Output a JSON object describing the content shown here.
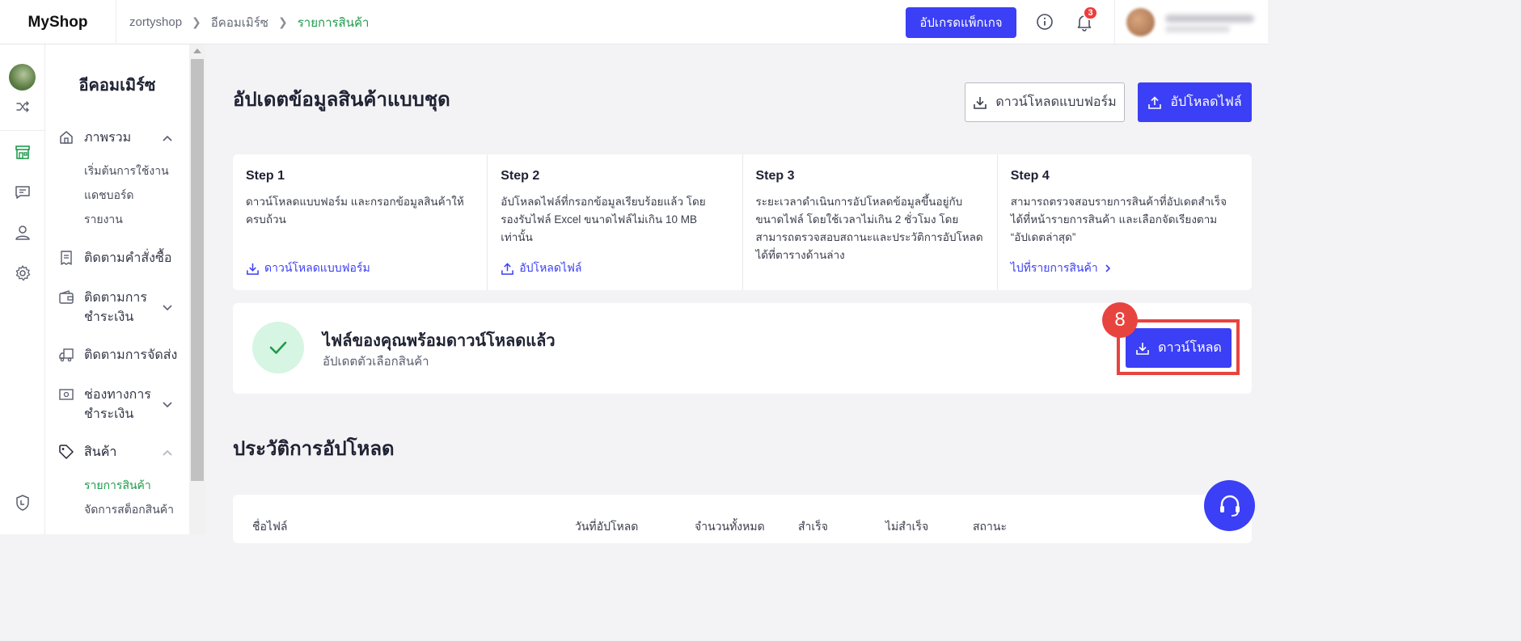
{
  "app": {
    "logo": "MyShop"
  },
  "breadcrumb": {
    "items": [
      "zortyshop",
      "อีคอมเมิร์ซ",
      "รายการสินค้า"
    ]
  },
  "topbar": {
    "upgrade_label": "อัปเกรดแพ็กเกจ",
    "notification_count": "3"
  },
  "sidebar": {
    "title": "อีคอมเมิร์ซ",
    "overview": {
      "label": "ภาพรวม",
      "subitems": [
        "เริ่มต้นการใช้งาน",
        "แดชบอร์ด",
        "รายงาน"
      ]
    },
    "order_tracking": "ติดตามคำสั่งซื้อ",
    "payment_tracking": "ติดตามการชำระเงิน",
    "shipping_tracking": "ติดตามการจัดส่ง",
    "payment_channels": "ช่องทางการชำระเงิน",
    "products": {
      "label": "สินค้า",
      "subitems": [
        "รายการสินค้า",
        "จัดการสต็อกสินค้า"
      ]
    }
  },
  "page": {
    "title": "อัปเดตข้อมูลสินค้าแบบชุด",
    "download_form_label": "ดาวน์โหลดแบบฟอร์ม",
    "upload_file_label": "อัปโหลดไฟล์"
  },
  "steps": [
    {
      "title": "Step 1",
      "desc": "ดาวน์โหลดแบบฟอร์ม และกรอกข้อมูลสินค้าให้ครบถ้วน",
      "link": "ดาวน์โหลดแบบฟอร์ม"
    },
    {
      "title": "Step 2",
      "desc": "อัปโหลดไฟล์ที่กรอกข้อมูลเรียบร้อยแล้ว โดยรองรับไฟล์ Excel ขนาดไฟล์ไม่เกิน 10 MB เท่านั้น",
      "link": "อัปโหลดไฟล์"
    },
    {
      "title": "Step 3",
      "desc": "ระยะเวลาดำเนินการอัปโหลดข้อมูลขึ้นอยู่กับขนาดไฟล์ โดยใช้เวลาไม่เกิน 2 ชั่วโมง โดยสามารถตรวจสอบสถานะและประวัติการอัปโหลดได้ที่ตารางด้านล่าง",
      "link": ""
    },
    {
      "title": "Step 4",
      "desc": "สามารถตรวจสอบรายการสินค้าที่อัปเดตสำเร็จได้ที่หน้ารายการสินค้า และเลือกจัดเรียงตาม “อัปเดตล่าสุด”",
      "link": "ไปที่รายการสินค้า"
    }
  ],
  "ready": {
    "title": "ไฟล์ของคุณพร้อมดาวน์โหลดแล้ว",
    "subtitle": "อัปเดตตัวเลือกสินค้า",
    "download_label": "ดาวน์โหลด",
    "step_badge": "8"
  },
  "history": {
    "title": "ประวัติการอัปโหลด",
    "columns": [
      "ชื่อไฟล์",
      "วันที่อัปโหลด",
      "จำนวนทั้งหมด",
      "สำเร็จ",
      "ไม่สำเร็จ",
      "สถานะ"
    ]
  },
  "colors": {
    "primary": "#3b3ff5",
    "active_green": "#1e9b4c",
    "highlight_red": "#e8443f",
    "badge_red": "#f03b3b"
  }
}
